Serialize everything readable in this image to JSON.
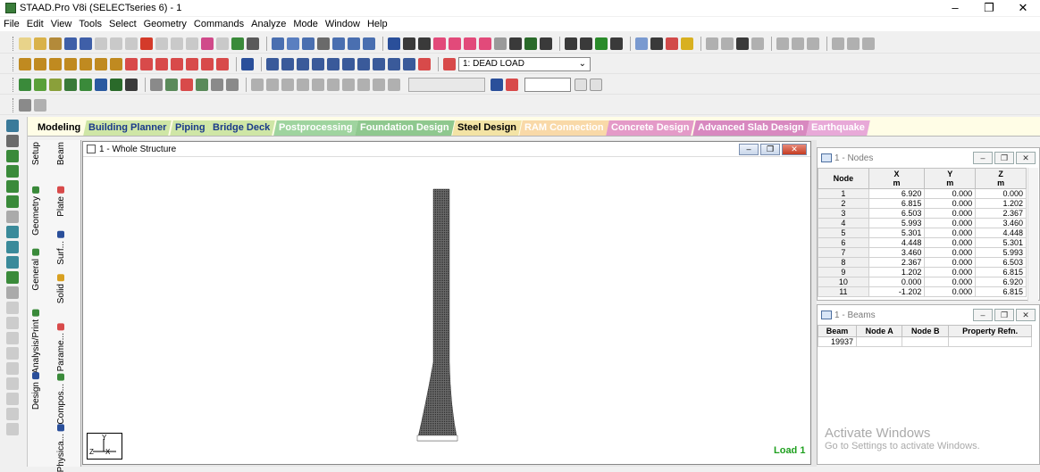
{
  "app": {
    "title": "STAAD.Pro V8i (SELECTseries 6) - 1",
    "window_buttons": [
      "–",
      "❐",
      "✕"
    ]
  },
  "menu": [
    "File",
    "Edit",
    "View",
    "Tools",
    "Select",
    "Geometry",
    "Commands",
    "Analyze",
    "Mode",
    "Window",
    "Help"
  ],
  "toolbar": {
    "load_case": "1: DEAD LOAD"
  },
  "tabs": [
    {
      "label": "Modeling",
      "bg": "#fffde6",
      "fg": "#000000"
    },
    {
      "label": "Building Planner",
      "bg": "#cfe6a6",
      "fg": "#1a3a8a"
    },
    {
      "label": "Piping",
      "bg": "#cfe6a6",
      "fg": "#1a3a8a"
    },
    {
      "label": "Bridge Deck",
      "bg": "#cfe6a6",
      "fg": "#1a3a8a"
    },
    {
      "label": "Postprocessing",
      "bg": "#9fd49f",
      "fg": "#ffffff"
    },
    {
      "label": "Foundation Design",
      "bg": "#8fc88f",
      "fg": "#ffffff"
    },
    {
      "label": "Steel Design",
      "bg": "#f3e3a5",
      "fg": "#000000"
    },
    {
      "label": "RAM Connection",
      "bg": "#f9d9a8",
      "fg": "#ffffff"
    },
    {
      "label": "Concrete Design",
      "bg": "#e49ac8",
      "fg": "#ffffff"
    },
    {
      "label": "Advanced Slab Design",
      "bg": "#d889c0",
      "fg": "#ffffff"
    },
    {
      "label": "Earthquake",
      "bg": "#e8a9d8",
      "fg": "#ffffff"
    }
  ],
  "side_tabs": {
    "setup": "Setup",
    "beam": "Beam",
    "geometry": "Geometry",
    "plate": "Plate",
    "general": "General",
    "surf": "Surf...",
    "solid": "Solid",
    "analysis": "Analysis/Print",
    "parame": "Parame...",
    "design": "Design",
    "compos": "Compos...",
    "physica": "Physica..."
  },
  "viewport": {
    "title": "1 - Whole Structure",
    "load_label": "Load 1",
    "axis_x": "X",
    "axis_y": "Y",
    "axis_z": "Z"
  },
  "nodes_table": {
    "title": "1 - Nodes",
    "headers": [
      "Node",
      "X\nm",
      "Y\nm",
      "Z\nm"
    ],
    "rows": [
      [
        "1",
        "6.920",
        "0.000",
        "0.000"
      ],
      [
        "2",
        "6.815",
        "0.000",
        "1.202"
      ],
      [
        "3",
        "6.503",
        "0.000",
        "2.367"
      ],
      [
        "4",
        "5.993",
        "0.000",
        "3.460"
      ],
      [
        "5",
        "5.301",
        "0.000",
        "4.448"
      ],
      [
        "6",
        "4.448",
        "0.000",
        "5.301"
      ],
      [
        "7",
        "3.460",
        "0.000",
        "5.993"
      ],
      [
        "8",
        "2.367",
        "0.000",
        "6.503"
      ],
      [
        "9",
        "1.202",
        "0.000",
        "6.815"
      ],
      [
        "10",
        "0.000",
        "0.000",
        "6.920"
      ],
      [
        "11",
        "-1.202",
        "0.000",
        "6.815"
      ]
    ]
  },
  "beams_table": {
    "title": "1 - Beams",
    "headers": [
      "Beam",
      "Node A",
      "Node B",
      "Property Refn."
    ],
    "rows": [
      [
        "19937",
        "",
        "",
        ""
      ]
    ]
  },
  "watermark": {
    "line1": "Activate Windows",
    "line2": "Go to Settings to activate Windows."
  }
}
